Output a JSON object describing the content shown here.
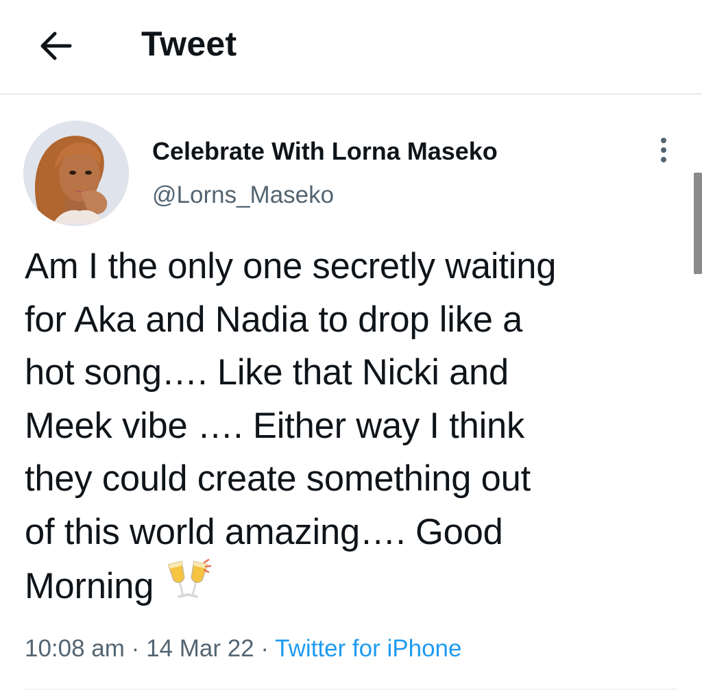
{
  "header": {
    "title": "Tweet",
    "back_icon": "arrow-left-icon"
  },
  "author": {
    "display_name": "Celebrate With Lorna Maseko",
    "handle": "@Lorns_Maseko",
    "avatar_icon": "profile-photo"
  },
  "tweet": {
    "text": "Am I the only one secretly waiting\nfor Aka and Nadia to drop like a\nhot song…. Like that Nicki and\nMeek vibe …. Either way I think\nthey could create something out\nof this world amazing…. Good\nMorning",
    "emoji": "clinking-glasses-icon"
  },
  "meta": {
    "time": "10:08 am",
    "separator": "·",
    "date": "14 Mar 22",
    "source": "Twitter for iPhone"
  },
  "colors": {
    "text": "#0f1419",
    "secondary": "#536471",
    "link": "#1d9bf0",
    "divider": "#e6ecf0"
  }
}
